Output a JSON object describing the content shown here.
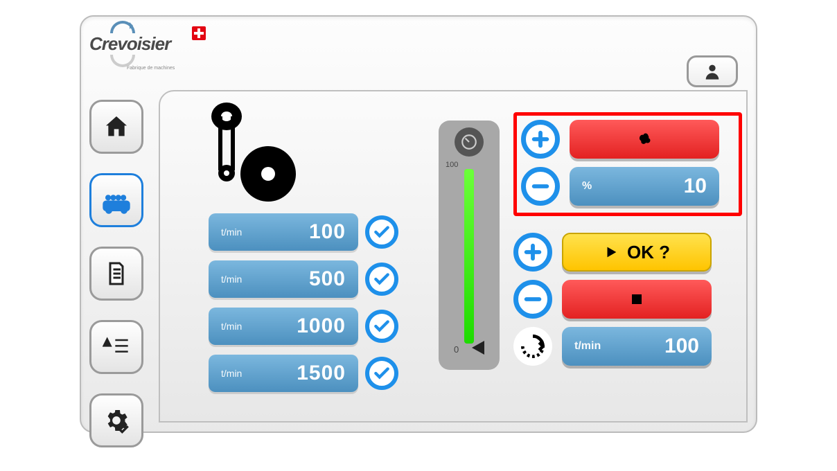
{
  "brand": {
    "name": "Crevoisier",
    "tagline": "Fabrique de machines"
  },
  "sidebar": {
    "items": [
      {
        "id": "home"
      },
      {
        "id": "machine"
      },
      {
        "id": "document"
      },
      {
        "id": "alarms"
      },
      {
        "id": "settings"
      }
    ],
    "active_index": 1
  },
  "speed_presets": [
    {
      "unit": "t/min",
      "value": "100"
    },
    {
      "unit": "t/min",
      "value": "500"
    },
    {
      "unit": "t/min",
      "value": "1000"
    },
    {
      "unit": "t/min",
      "value": "1500"
    }
  ],
  "gauge": {
    "top_label": "100",
    "bottom_label": "0",
    "fill_percent": 100
  },
  "fan": {
    "percent_label": "%",
    "percent_value": "10"
  },
  "confirm": {
    "label": "OK ?"
  },
  "current_speed": {
    "unit": "t/min",
    "value": "100"
  }
}
